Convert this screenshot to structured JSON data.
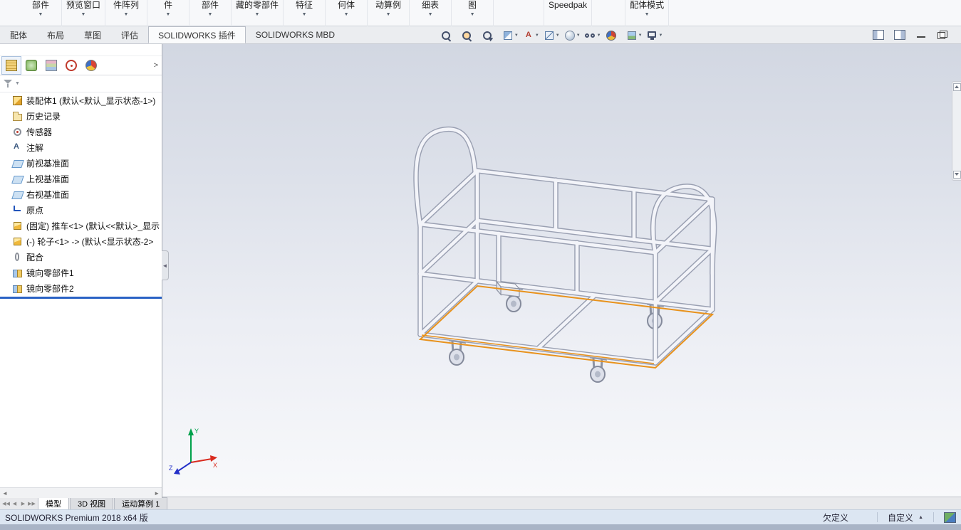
{
  "ribbon": {
    "groups": [
      {
        "label": "部件",
        "caret": true
      },
      {
        "label": "预览窗口",
        "caret": true
      },
      {
        "label": "件阵列",
        "caret": true
      },
      {
        "label": "件",
        "caret": true
      },
      {
        "label": "部件",
        "caret": true
      },
      {
        "label": "藏的零部件",
        "caret": true
      },
      {
        "label": "特征",
        "caret": true
      },
      {
        "label": "何体",
        "caret": true
      },
      {
        "label": "动算例",
        "caret": true
      },
      {
        "label": "细表",
        "caret": true
      },
      {
        "label": "图",
        "caret": true
      },
      {
        "label": "Speedpak",
        "caret": false
      },
      {
        "label": "配体模式",
        "caret": true
      }
    ]
  },
  "command_tabs": {
    "items": [
      {
        "label": "配体",
        "active": false
      },
      {
        "label": "布局",
        "active": false
      },
      {
        "label": "草图",
        "active": false
      },
      {
        "label": "评估",
        "active": false
      },
      {
        "label": "SOLIDWORKS 插件",
        "active": true
      },
      {
        "label": "SOLIDWORKS MBD",
        "active": false
      }
    ]
  },
  "headsup": {
    "icons": [
      {
        "icon": "zoom-fit-icon",
        "caret": false
      },
      {
        "icon": "zoom-area-icon",
        "caret": false
      },
      {
        "icon": "previous-view-icon",
        "caret": false
      },
      {
        "icon": "section-view-icon",
        "caret": true
      },
      {
        "icon": "view-annotations-icon",
        "caret": true
      },
      {
        "icon": "view-orientation-icon",
        "caret": true
      },
      {
        "icon": "display-style-icon",
        "caret": true
      },
      {
        "icon": "hide-items-icon",
        "caret": true
      },
      {
        "icon": "edit-appearance-icon",
        "caret": false
      },
      {
        "icon": "apply-scene-icon",
        "caret": true
      },
      {
        "icon": "view-settings-icon",
        "caret": true
      }
    ]
  },
  "window_controls": {
    "icons": [
      "pane-left-icon",
      "pane-right-icon",
      "minimize-icon",
      "restore-icon"
    ]
  },
  "feature_panel": {
    "tabs": [
      {
        "icon": "featuremanager-tab-icon",
        "active": true
      },
      {
        "icon": "propertymanager-tab-icon",
        "active": false
      },
      {
        "icon": "configurationmanager-tab-icon",
        "active": false
      },
      {
        "icon": "dimxpert-tab-icon",
        "active": false
      },
      {
        "icon": "displaymanager-tab-icon",
        "active": false
      }
    ],
    "expand_arrow": ">",
    "tree": {
      "items": [
        {
          "icon": "assembly-icon",
          "label": "装配体1 (默认<默认_显示状态-1>)"
        },
        {
          "icon": "history-icon",
          "label": "历史记录"
        },
        {
          "icon": "sensors-icon",
          "label": "传感器"
        },
        {
          "icon": "annotations-icon",
          "label": "注解"
        },
        {
          "icon": "plane-icon",
          "label": "前视基准面"
        },
        {
          "icon": "plane-icon",
          "label": "上视基准面"
        },
        {
          "icon": "plane-icon",
          "label": "右视基准面"
        },
        {
          "icon": "origin-icon",
          "label": "原点"
        },
        {
          "icon": "part-icon",
          "label": "(固定) 推车<1> (默认<<默认>_显示"
        },
        {
          "icon": "part-icon",
          "label": "(-) 轮子<1> -> (默认<显示状态-2>"
        },
        {
          "icon": "mates-icon",
          "label": "配合"
        },
        {
          "icon": "mirror-icon",
          "label": "镜向零部件1"
        },
        {
          "icon": "mirror-icon",
          "label": "镜向零部件2"
        }
      ]
    }
  },
  "viewport": {
    "triad": {
      "x": "X",
      "y": "Y",
      "z": "Z"
    },
    "selection_color": "#e8921c"
  },
  "motion_tabs": {
    "items": [
      {
        "label": "模型",
        "active": true
      },
      {
        "label": "3D 视图",
        "active": false
      },
      {
        "label": "运动算例 1",
        "active": false
      }
    ]
  },
  "statusbar": {
    "left": "SOLIDWORKS Premium 2018 x64 版",
    "define_state": "欠定义",
    "custom": "自定义"
  }
}
